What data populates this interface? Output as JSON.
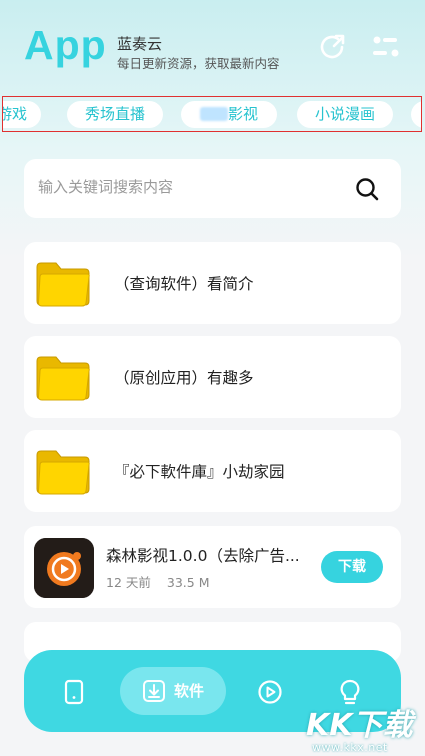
{
  "header": {
    "logo": "App",
    "name": "蓝奏云",
    "subtitle": "每日更新资源，获取最新内容",
    "icons": [
      "refresh-icon",
      "settings-sliders-icon"
    ]
  },
  "tabs": [
    {
      "label": "游戏"
    },
    {
      "label": "秀场直播"
    },
    {
      "label": "影视"
    },
    {
      "label": "小说漫画"
    }
  ],
  "search": {
    "placeholder": "输入关键词搜索内容",
    "icon": "search-icon"
  },
  "list": {
    "folders": [
      {
        "title": "（查询软件）看简介"
      },
      {
        "title": "（原创应用）有趣多"
      },
      {
        "title": "『必下軟件庫』小劫家园"
      }
    ],
    "app": {
      "title": "森林影视1.0.0（去除广告...",
      "age": "12 天前",
      "size": "33.5 M",
      "download_label": "下载"
    }
  },
  "bottom_nav": {
    "active_label": "软件",
    "items": [
      "phone-icon",
      "download-box-icon",
      "play-circle-icon",
      "lightbulb-icon"
    ]
  },
  "watermark": {
    "logo": "KK下载",
    "url": "www.kkx.net"
  },
  "colors": {
    "accent": "#36d3df",
    "nav": "#3fd8e2",
    "folder": "#ffd200"
  }
}
